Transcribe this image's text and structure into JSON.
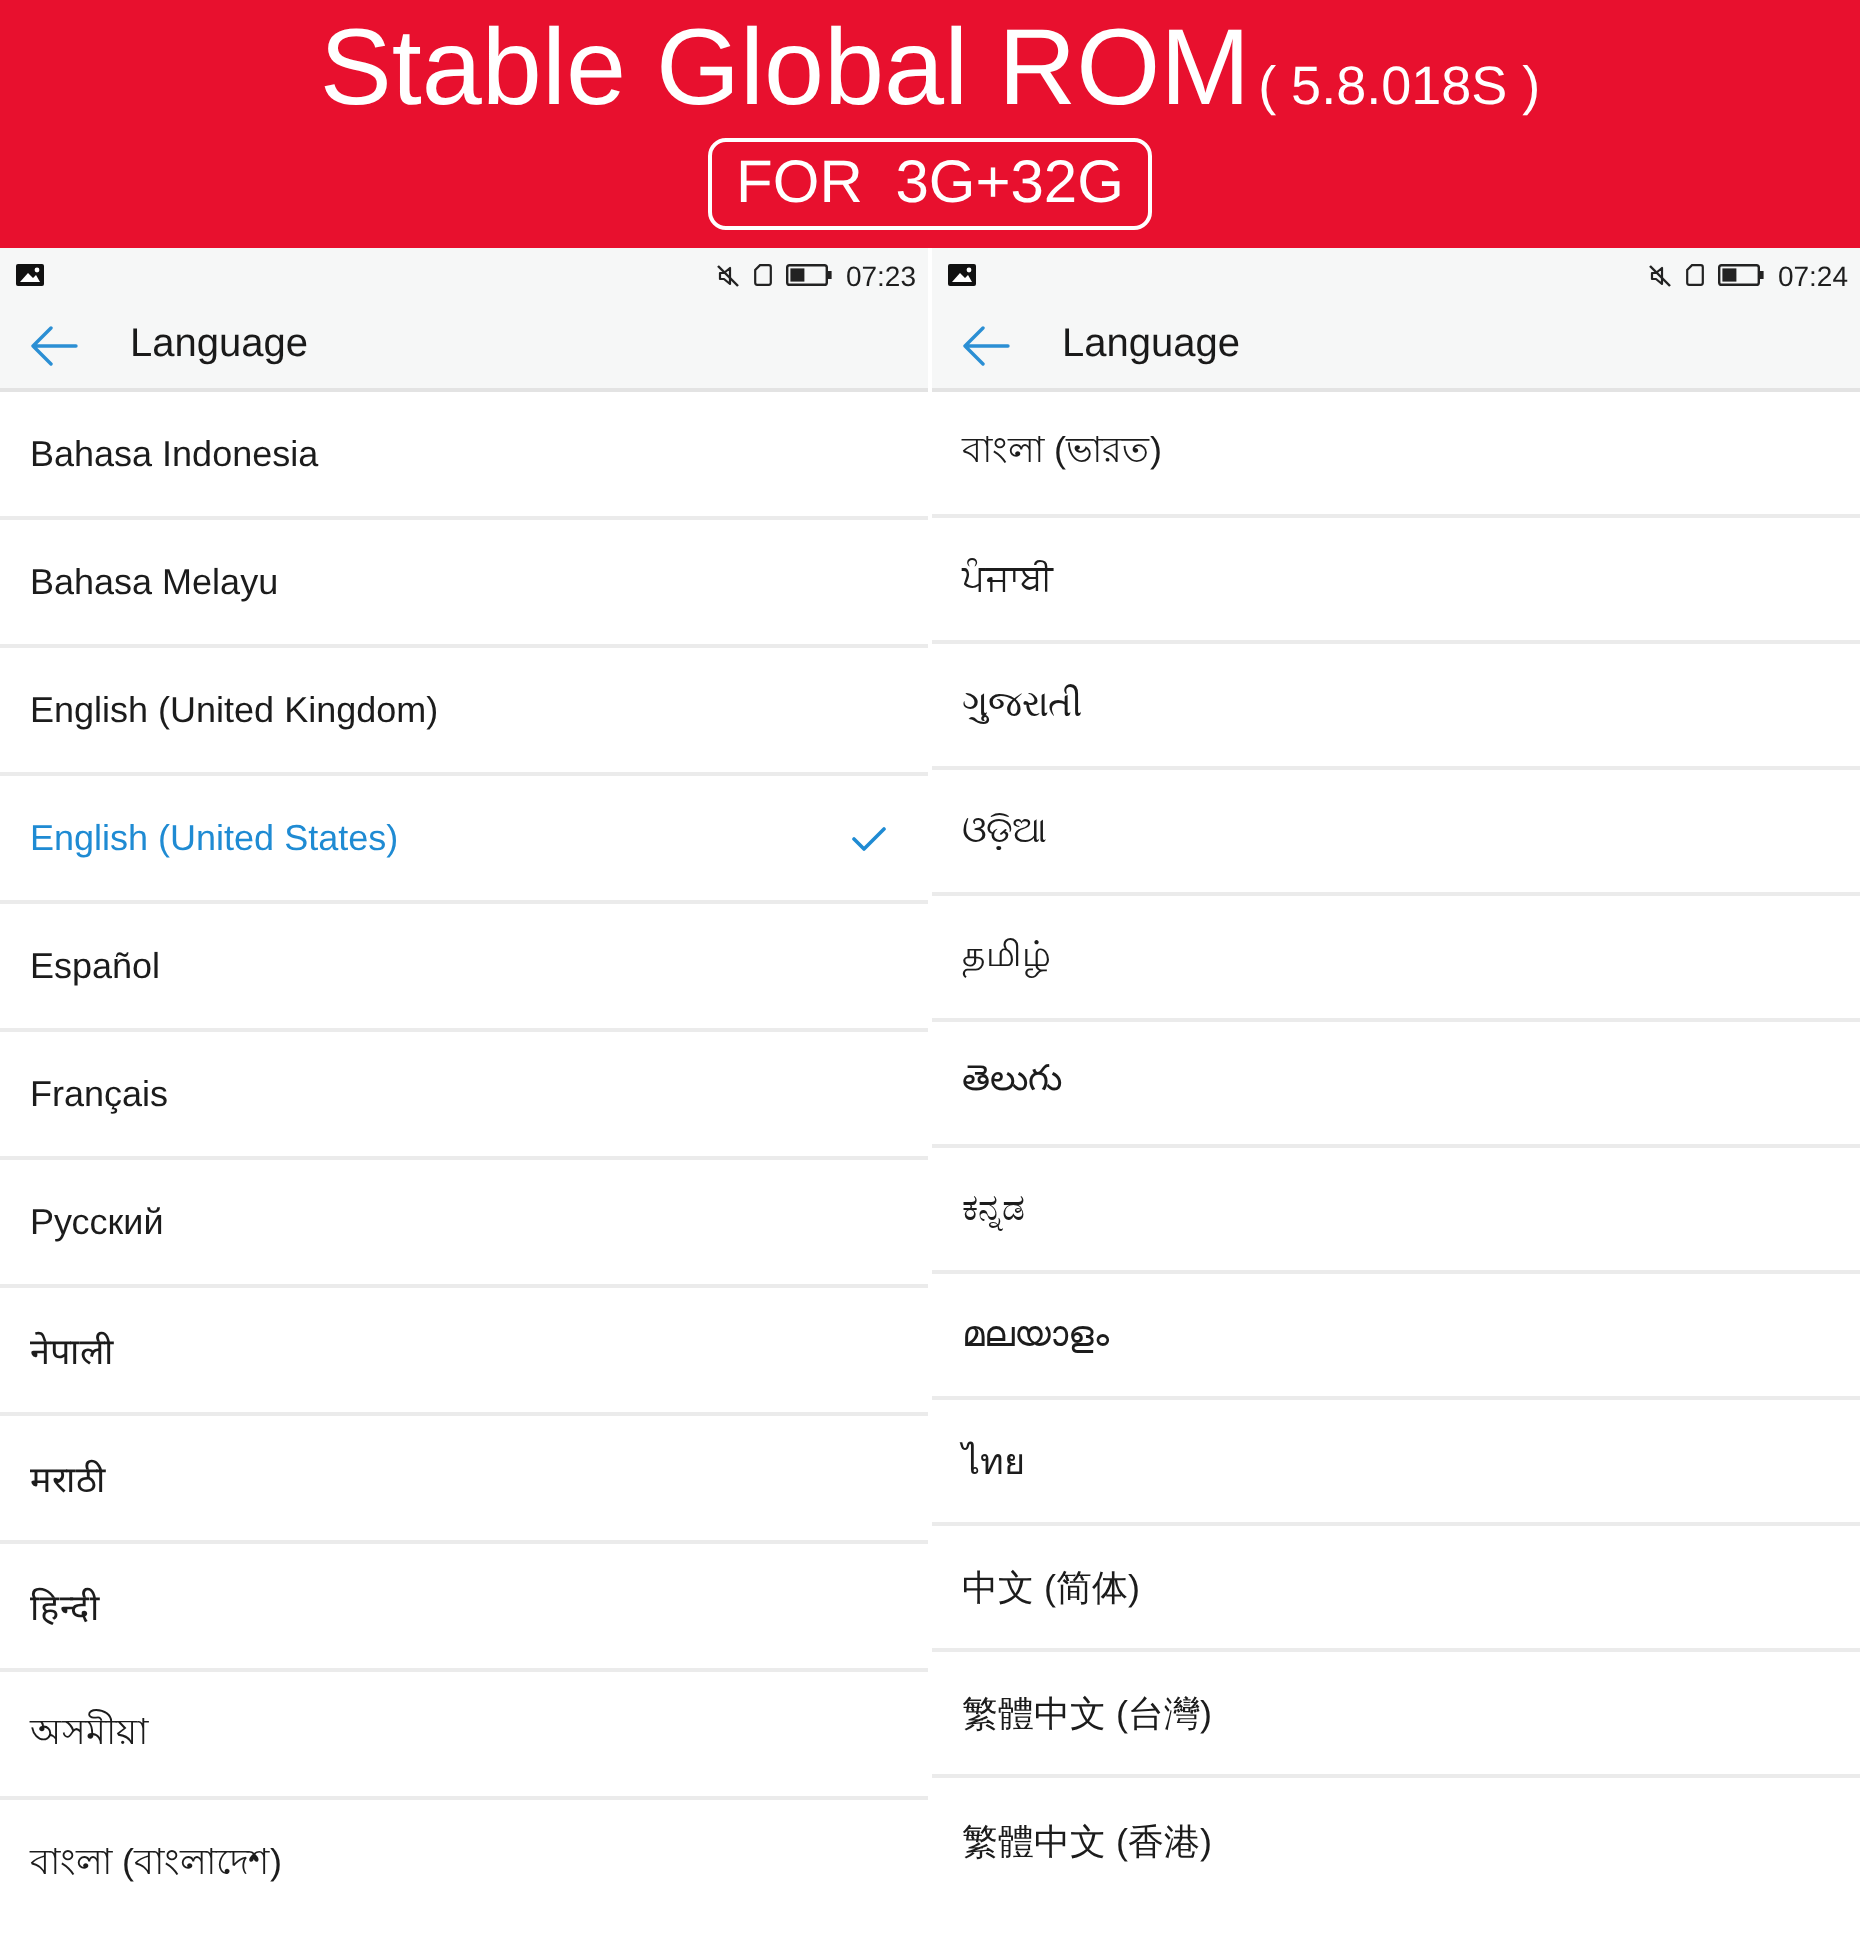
{
  "banner": {
    "title": "Stable Global ROM",
    "version": "( 5.8.018S )",
    "tag": "FOR 3G+32G"
  },
  "screens": [
    {
      "status_bar": {
        "time": "07:23"
      },
      "header": {
        "title": "Language"
      },
      "languages": [
        {
          "label": "Bahasa Indonesia",
          "selected": false
        },
        {
          "label": "Bahasa Melayu",
          "selected": false
        },
        {
          "label": "English (United Kingdom)",
          "selected": false
        },
        {
          "label": "English (United States)",
          "selected": true
        },
        {
          "label": "Español",
          "selected": false
        },
        {
          "label": "Français",
          "selected": false
        },
        {
          "label": "Русский",
          "selected": false
        },
        {
          "label": "नेपाली",
          "selected": false
        },
        {
          "label": "मराठी",
          "selected": false
        },
        {
          "label": "हिन्दी",
          "selected": false
        },
        {
          "label": "অসমীয়া",
          "selected": false
        },
        {
          "label": "বাংলা (বাংলাদেশ)",
          "selected": false
        }
      ]
    },
    {
      "status_bar": {
        "time": "07:24"
      },
      "header": {
        "title": "Language"
      },
      "languages": [
        {
          "label": "বাংলা (ভারত)",
          "selected": false
        },
        {
          "label": "ਪੰਜਾਬੀ",
          "selected": false
        },
        {
          "label": "ગુજરાતી",
          "selected": false
        },
        {
          "label": "ଓଡ଼ିଆ",
          "selected": false
        },
        {
          "label": "தமிழ்",
          "selected": false
        },
        {
          "label": "తెలుగు",
          "selected": false
        },
        {
          "label": "ಕನ್ನಡ",
          "selected": false
        },
        {
          "label": "മലയാളം",
          "selected": false
        },
        {
          "label": "ไทย",
          "selected": false
        },
        {
          "label": "中文 (简体)",
          "selected": false
        },
        {
          "label": "繁體中文 (台灣)",
          "selected": false
        },
        {
          "label": "繁體中文 (香港)",
          "selected": false
        }
      ]
    }
  ]
}
